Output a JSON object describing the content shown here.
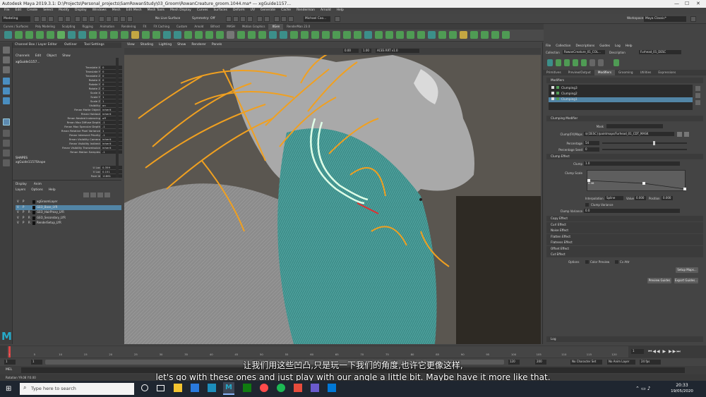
{
  "title_bar": {
    "text": "Autodesk Maya 2019.3.1: D:\\Projects\\Personal_projects\\SamRowanStudy\\03_Groom\\RowanCreature_groom.1044.ma* --- xgGuide1157..."
  },
  "menu": [
    "File",
    "Edit",
    "Create",
    "Select",
    "Modify",
    "Display",
    "Windows",
    "Mesh",
    "Edit Mesh",
    "Mesh Tools",
    "Mesh Display",
    "Curves",
    "Surfaces",
    "Deform",
    "UV",
    "Generate",
    "Cache",
    "Renderman",
    "Arnold",
    "Help"
  ],
  "status": {
    "mode": "Modeling",
    "no_live": "No Live Surface",
    "symmetry": "Symmetry: Off",
    "user": "Michael Cao...",
    "workspace_label": "Workspace:",
    "workspace": "Maya Classic*"
  },
  "shelf_tabs": [
    "Curves / Surfaces",
    "Poly Modeling",
    "Sculpting",
    "Rigging",
    "Animation",
    "Rendering",
    "FX",
    "FX Caching",
    "Custom",
    "Arnold",
    "Bifrost",
    "MASH",
    "Motion Graphics",
    "XGen",
    "RenderMan 23.0"
  ],
  "shelf_active": "XGen",
  "channel_box": {
    "tabs": [
      "Channel Box / Layer Editor",
      "Outliner",
      "Tool Settings"
    ],
    "menus": [
      "Channels",
      "Edit",
      "Object",
      "Show"
    ],
    "object": "xgGuide1157...",
    "rows": [
      {
        "label": "Translate X",
        "value": "0"
      },
      {
        "label": "Translate Y",
        "value": "0"
      },
      {
        "label": "Translate Z",
        "value": "0"
      },
      {
        "label": "Rotate X",
        "value": "0"
      },
      {
        "label": "Rotate Y",
        "value": "0"
      },
      {
        "label": "Rotate Z",
        "value": "0"
      },
      {
        "label": "Scale X",
        "value": "1"
      },
      {
        "label": "Scale Y",
        "value": "1"
      },
      {
        "label": "Scale Z",
        "value": "1"
      },
      {
        "label": "Visibility",
        "value": "on"
      },
      {
        "label": "Rman Matte Object",
        "value": "inherit"
      },
      {
        "label": "Rman Holdout",
        "value": "inherit"
      },
      {
        "label": "Rman Nested Instancing",
        "value": "off"
      },
      {
        "label": "Rman Max Diffuse Depth",
        "value": "-1"
      },
      {
        "label": "Rman Max Specular Depth",
        "value": "-1"
      },
      {
        "label": "Rman Relative Pixel Variance",
        "value": "1"
      },
      {
        "label": "Rman Intersect Priority",
        "value": "-1"
      },
      {
        "label": "Rman Visibility Camera",
        "value": "inherit"
      },
      {
        "label": "Rman Visibility Indirect",
        "value": "inherit"
      },
      {
        "label": "Rman Visibility Transmission",
        "value": "inherit"
      },
      {
        "label": "Rman Motion Samples",
        "value": "-1"
      }
    ],
    "shapes_label": "SHAPES",
    "shape_name": "xgGuide1157Shape",
    "shape_rows": [
      {
        "label": "U Loc",
        "value": "0.359"
      },
      {
        "label": "V Loc",
        "value": "0.151"
      },
      {
        "label": "Face Id",
        "value": "11861"
      }
    ]
  },
  "layer_editor": {
    "tabs": [
      "Display",
      "Anim"
    ],
    "menus": [
      "Layers",
      "Options",
      "Help"
    ],
    "layers": [
      {
        "v": "V",
        "p": "P",
        "r": "",
        "name": "xgGroomLayer",
        "selected": false
      },
      {
        "v": "V",
        "p": "P",
        "r": "",
        "name": "GEO_Base_LYR",
        "selected": true
      },
      {
        "v": "V",
        "p": "P",
        "r": "R",
        "name": "GEO_HairProxy_LYR",
        "selected": false
      },
      {
        "v": "V",
        "p": "P",
        "r": "R",
        "name": "GEO_Secondary_LYR",
        "selected": false
      },
      {
        "v": "V",
        "p": "P",
        "r": "R",
        "name": "RenderSetup_LYR",
        "selected": false
      }
    ]
  },
  "viewport": {
    "menus": [
      "View",
      "Shading",
      "Lighting",
      "Show",
      "Renderer",
      "Panels"
    ],
    "field_a": "0.00",
    "field_b": "1.00",
    "colorspace": "ACES RRT v1.0"
  },
  "attribute_editor": {
    "menus": [
      "File",
      "Collection",
      "Descriptions",
      "Guides",
      "Log",
      "Help"
    ],
    "collection_label": "Collection",
    "collection": "RowanCreature_01_COL...",
    "description_label": "Description",
    "description": "Furhead_01_DESC",
    "tabs": [
      "Primitives",
      "Preview/Output",
      "Modifiers",
      "Grooming",
      "Utilities",
      "Expressions"
    ],
    "active_tab": "Modifiers",
    "modifiers_header": "Modifiers",
    "modifiers": [
      {
        "name": "Clumping3",
        "selected": false
      },
      {
        "name": "Clumping2",
        "selected": false
      },
      {
        "name": "Clumping1",
        "selected": true
      }
    ],
    "clump_header": "Clumping Modifier",
    "mask_label": "Mask",
    "clump_map_label": "Clump(FX)Maps",
    "clump_map": "${DESC}/paintmaps/Furhead_01_CDT_MASK",
    "percentage_label": "Percentage",
    "percentage": "54",
    "percentage_seed_label": "Percentage Seed",
    "percentage_seed": "0",
    "clump_effect_label": "Clump Effect",
    "clump_label": "Clump",
    "clump_value": "1.0",
    "clump_scale_label": "Clump Scale",
    "curve_point": "0.46",
    "interp_label": "Interpolation",
    "interp": "Spline",
    "value_label": "Value",
    "value": "0.000",
    "position_label": "Position",
    "position": "0.000",
    "clump_variance_check": "Clump Variance",
    "clump_variance_label": "Clump Variance",
    "clump_variance": "0.0",
    "sections": [
      "Copy Effect",
      "Curl Effect",
      "Noise Effect",
      "Flatten Effect",
      "Flatness Effect",
      "Offset Effect",
      "Cut Effect"
    ],
    "options_label": "Options",
    "color_preview": "Color Preview",
    "cv_attr": "Cv Attr",
    "setup_maps": "Setup Maps...",
    "preview_guides": "Preview Guides",
    "export_guides": "Export Guides...",
    "log_label": "Log"
  },
  "timeline": {
    "ticks": [
      "1",
      "5",
      "10",
      "15",
      "20",
      "25",
      "30",
      "35",
      "40",
      "45",
      "50",
      "55",
      "60",
      "65",
      "70",
      "75",
      "80",
      "85",
      "90",
      "95",
      "100",
      "105",
      "110",
      "115",
      "120"
    ],
    "current": "1",
    "range_start": "1",
    "range_in": "1",
    "range_out": "120",
    "range_end": "120",
    "range_end2": "200",
    "char_set": "No Character Set",
    "anim_layer": "No Anim Layer",
    "fps": "24 fps"
  },
  "mel": {
    "label": "MEL",
    "help": "Rotation   Y9.08   Y:0.00"
  },
  "taskbar": {
    "search": "Type here to search",
    "time": "20:33",
    "date": "19/05/2020"
  },
  "subtitles": {
    "cn": "让我们用这些凹凸,只是玩一下我们的角度,也许它更像这样,",
    "en": "let's go with these ones and just play with our angle a little bit. Maybe have it more like that."
  },
  "colors": {
    "teal_fur": "#3f8e8a",
    "orange_guides": "#f0a020",
    "selection": "#5285a6",
    "maya_logo": "#26a9c8"
  }
}
